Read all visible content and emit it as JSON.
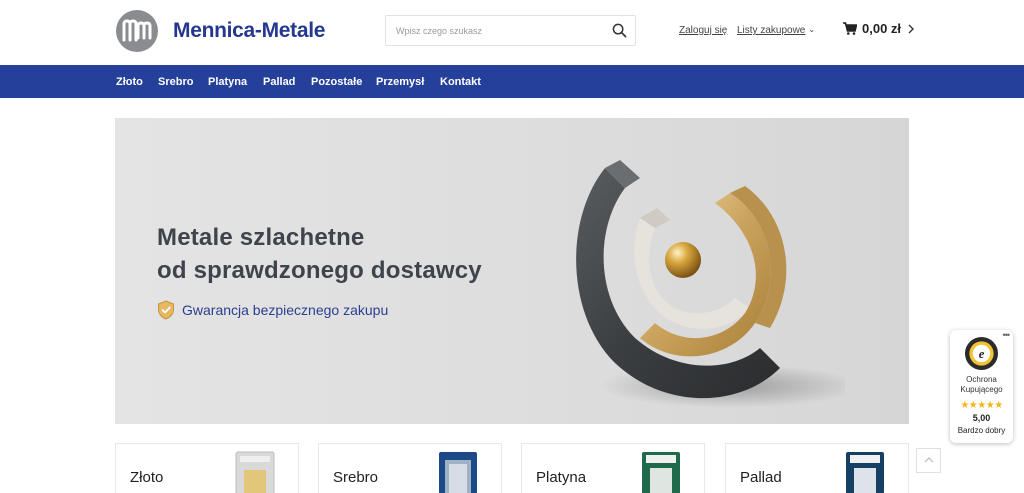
{
  "header": {
    "brand": "Mennica-Metale",
    "search_placeholder": "Wpisz czego szukasz",
    "login_label": "Zaloguj się",
    "lists_label": "Listy zakupowe",
    "cart_total": "0,00 zł",
    "icons": {
      "search": "search-icon",
      "cart": "cart-icon",
      "chevron": "chevron-right-icon"
    }
  },
  "nav": {
    "items": [
      {
        "label": "Złoto"
      },
      {
        "label": "Srebro"
      },
      {
        "label": "Platyna"
      },
      {
        "label": "Pallad"
      },
      {
        "label": "Pozostałe"
      },
      {
        "label": "Przemysł"
      },
      {
        "label": "Kontakt"
      }
    ]
  },
  "hero": {
    "title_line1": "Metale szlachetne",
    "title_line2": "od sprawdzonego dostawcy",
    "guarantee": "Gwarancja bezpiecznego zakupu"
  },
  "categories": [
    {
      "label": "Złoto"
    },
    {
      "label": "Srebro"
    },
    {
      "label": "Platyna"
    },
    {
      "label": "Pallad"
    }
  ],
  "trust_badge": {
    "line1": "Ochrona",
    "line2": "Kupującego",
    "stars": "★★★★★",
    "rating_stars": 5,
    "score": "5,00",
    "rating_text": "Bardzo dobry"
  },
  "colors": {
    "brand_blue": "#24388f",
    "nav_blue": "#24409a",
    "star_gold": "#f3b71d"
  }
}
